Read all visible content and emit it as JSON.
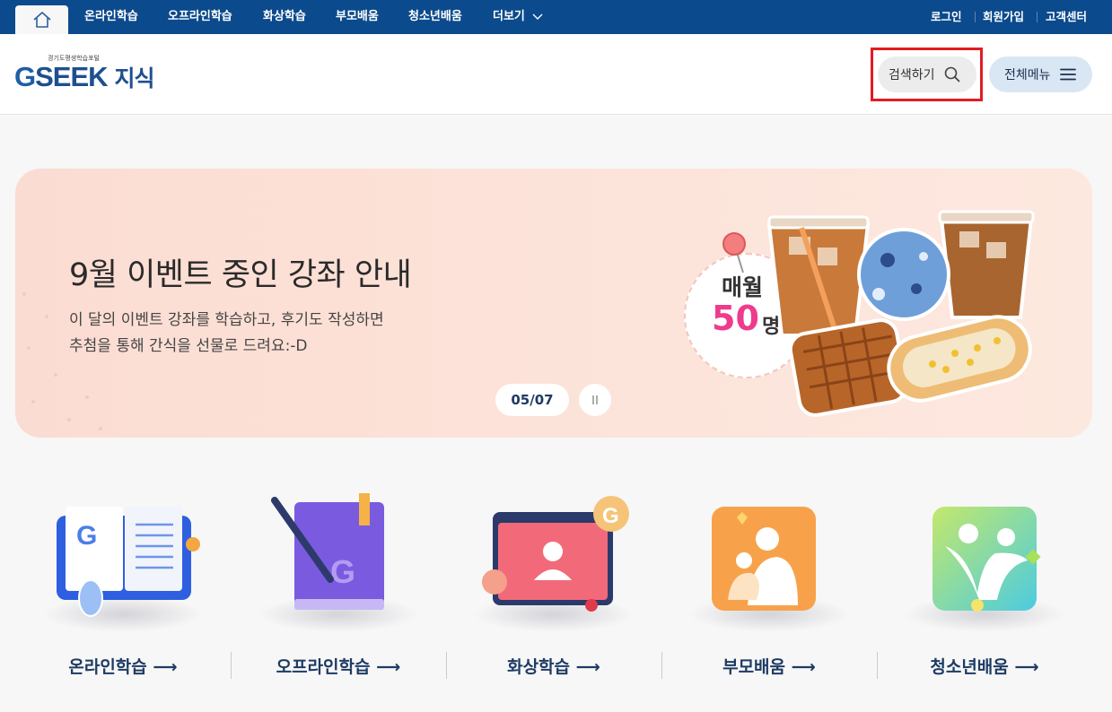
{
  "topnav": {
    "items": [
      "온라인학습",
      "오프라인학습",
      "화상학습",
      "부모배움",
      "청소년배움",
      "더보기"
    ],
    "right": [
      "로그인",
      "회원가입",
      "고객센터"
    ]
  },
  "header": {
    "logo_sub": "경기도평생학습포털",
    "logo_g": "G",
    "logo_seek": "SEEK",
    "logo_jisik": "지식",
    "search_label": "검색하기",
    "menu_label": "전체메뉴"
  },
  "banner": {
    "title": "9월 이벤트 중인 강좌 안내",
    "desc": "이 달의 이벤트 강좌를 학습하고, 후기도 작성하면\n추첨을 통해 간식을 선물로 드려요:-D",
    "counter": "05/07",
    "promo_line1": "매월",
    "promo_num": "50",
    "promo_unit": "명"
  },
  "categories": [
    "온라인학습",
    "오프라인학습",
    "화상학습",
    "부모배움",
    "청소년배움"
  ],
  "colors": {
    "nav": "#0b4a8c",
    "accent": "#e31b23",
    "brand": "#1e5ea6"
  }
}
